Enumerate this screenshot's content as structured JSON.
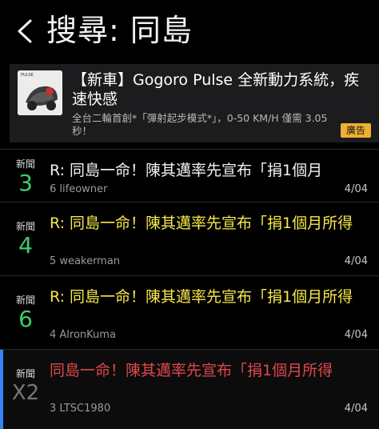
{
  "header": {
    "title": "搜尋: 同島"
  },
  "ad": {
    "title": "【新車】Gogoro Pulse 全新動力系統，疾速快感",
    "description": "全台二輪首創*「彈射起步模式*」，0-50 KM/H 僅需 3.05 秒！",
    "badge": "廣告",
    "thumb_text": "PULSE"
  },
  "posts": [
    {
      "tag": "新聞",
      "count": "3",
      "title": "R: 同島一命！陳其邁率先宣布「捐1個月",
      "author": "6 lifeowner",
      "date": "4/04",
      "color": "white"
    },
    {
      "tag": "新聞",
      "count": "4",
      "title": "R: 同島一命！陳其邁率先宣布「捐1個月所得",
      "author": "5 weakerman",
      "date": "4/04",
      "color": "yellow"
    },
    {
      "tag": "新聞",
      "count": "6",
      "title": "R: 同島一命！陳其邁率先宣布「捐1個月所得",
      "author": "4 AlronKuma",
      "date": "4/04",
      "color": "yellow"
    },
    {
      "tag": "新聞",
      "count": "X2",
      "title": "同島一命！陳其邁率先宣布「捐1個月所得",
      "author": "3 LTSC1980",
      "date": "4/04",
      "color": "red"
    }
  ],
  "colors": {
    "accent": "#3b82f6",
    "green": "#3ad06b",
    "yellow": "#f7e84a",
    "red": "#e0474a",
    "badge": "#f0b030"
  }
}
